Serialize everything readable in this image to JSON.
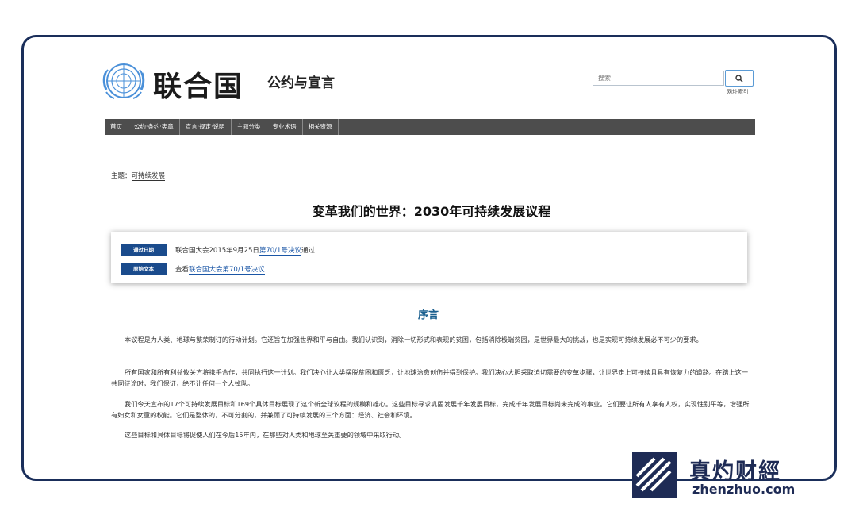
{
  "header": {
    "org_name": "联合国",
    "section_name": "公约与宣言",
    "search_placeholder": "搜索",
    "sitemap_label": "网址索引"
  },
  "nav": {
    "items": [
      "首页",
      "公约·条约·宪章",
      "宣言·规定·说明",
      "主题分类",
      "专业术语",
      "相关资源"
    ]
  },
  "breadcrumb": {
    "prefix": "主题：",
    "topic": "可持续发展"
  },
  "page_title": "变革我们的世界：2030年可持续发展议程",
  "info": {
    "adopted_label": "通过日期",
    "adopted_text_before": "联合国大会2015年9月25日",
    "adopted_link": "第70/1号决议",
    "adopted_text_after": "通过",
    "original_label": "原始文本",
    "original_text_before": "查看",
    "original_link": "联合国大会第70/1号决议"
  },
  "preamble": {
    "title": "序言",
    "paragraphs": [
      "本议程是为人类、地球与繁荣制订的行动计划。它还旨在加强世界和平与自由。我们认识到，消除一切形式和表现的贫困，包括消除极端贫困，是世界最大的挑战，也是实现可持续发展必不可少的要求。",
      "所有国家和所有利益攸关方将携手合作，共同执行这一计划。我们决心让人类摆脱贫困和匮乏，让地球治愈创伤并得到保护。我们决心大胆采取迫切需要的变革步骤，让世界走上可持续且具有恢复力的道路。在踏上这一共同征途时，我们保证，绝不让任何一个人掉队。",
      "我们今天宣布的17个可持续发展目标和169个具体目标展现了这个新全球议程的规模和雄心。这些目标寻求巩固发展千年发展目标，完成千年发展目标尚未完成的事业。它们要让所有人享有人权，实现性别平等，增强所有妇女和女童的权能。它们是整体的，不可分割的，并兼顾了可持续发展的三个方面：经济、社会和环境。",
      "这些目标和具体目标将促使人们在今后15年内，在那些对人类和地球至关重要的领域中采取行动。"
    ]
  },
  "watermark": {
    "name": "真灼财經",
    "url": "zhenzhuo.com"
  }
}
